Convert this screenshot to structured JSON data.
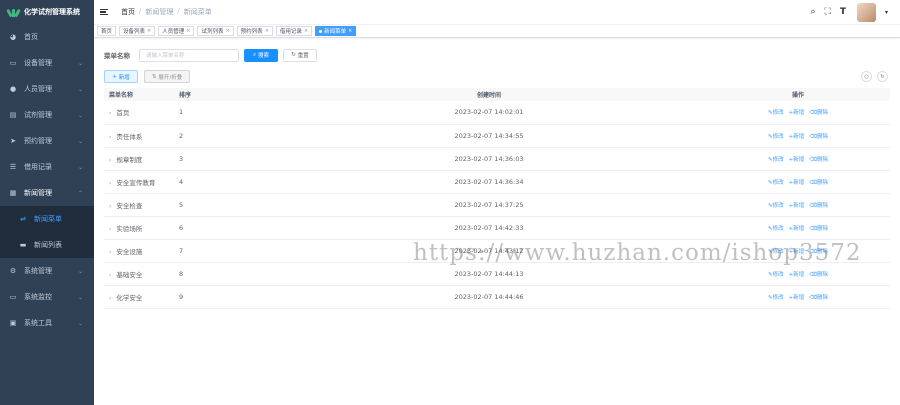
{
  "app": {
    "title": "化学试剂管理系统"
  },
  "sidebar": {
    "items": [
      {
        "label": "首页",
        "icon": "dashboard-icon"
      },
      {
        "label": "设备管理",
        "icon": "monitor-icon"
      },
      {
        "label": "人员管理",
        "icon": "user-icon"
      },
      {
        "label": "试剂管理",
        "icon": "flask-icon"
      },
      {
        "label": "预约管理",
        "icon": "send-icon"
      },
      {
        "label": "借用记录",
        "icon": "list-icon"
      },
      {
        "label": "新闻管理",
        "icon": "document-icon"
      }
    ],
    "news_sub": [
      {
        "label": "新闻菜单",
        "icon": "link-icon"
      },
      {
        "label": "新闻列表",
        "icon": "message-icon"
      }
    ],
    "items_after": [
      {
        "label": "系统管理",
        "icon": "gear-icon"
      },
      {
        "label": "系统监控",
        "icon": "monitor-icon"
      },
      {
        "label": "系统工具",
        "icon": "tool-icon"
      }
    ]
  },
  "breadcrumb": [
    "首页",
    "新闻管理",
    "新闻菜单"
  ],
  "tags": [
    {
      "label": "首页",
      "closable": false,
      "active": false
    },
    {
      "label": "设备列表",
      "closable": true,
      "active": false
    },
    {
      "label": "人员管理",
      "closable": true,
      "active": false
    },
    {
      "label": "试剂列表",
      "closable": true,
      "active": false
    },
    {
      "label": "预约列表",
      "closable": true,
      "active": false
    },
    {
      "label": "借用记录",
      "closable": true,
      "active": false
    },
    {
      "label": "新闻菜单",
      "closable": true,
      "active": true
    }
  ],
  "search": {
    "label": "菜单名称",
    "placeholder": "请输入菜单名称",
    "search_btn": "搜索",
    "reset_btn": "重置"
  },
  "toolbar": {
    "add_btn": "新增",
    "expand_btn": "展开/折叠"
  },
  "table": {
    "headers": {
      "name": "菜单名称",
      "sort": "排序",
      "time": "创建时间",
      "op": "操作"
    },
    "op_labels": {
      "edit": "修改",
      "add": "新增",
      "del": "删除"
    },
    "rows": [
      {
        "name": "首页",
        "sort": "1",
        "time": "2023-02-07 14:02:01"
      },
      {
        "name": "责任体系",
        "sort": "2",
        "time": "2023-02-07 14:34:55"
      },
      {
        "name": "规章制度",
        "sort": "3",
        "time": "2023-02-07 14:36:03"
      },
      {
        "name": "安全宣传教育",
        "sort": "4",
        "time": "2023-02-07 14:36:34"
      },
      {
        "name": "安全检查",
        "sort": "5",
        "time": "2023-02-07 14:37:25"
      },
      {
        "name": "实验场所",
        "sort": "6",
        "time": "2023-02-07 14:42:33"
      },
      {
        "name": "安全设施",
        "sort": "7",
        "time": "2023-02-07 14:43:12"
      },
      {
        "name": "基础安全",
        "sort": "8",
        "time": "2023-02-07 14:44:13"
      },
      {
        "name": "化学安全",
        "sort": "9",
        "time": "2023-02-07 14:44:46"
      }
    ]
  },
  "watermark": "https://www.huzhan.com/ishop3572",
  "colors": {
    "sidebar": "#304156",
    "primary": "#1890ff",
    "active_menu": "#409eff"
  }
}
